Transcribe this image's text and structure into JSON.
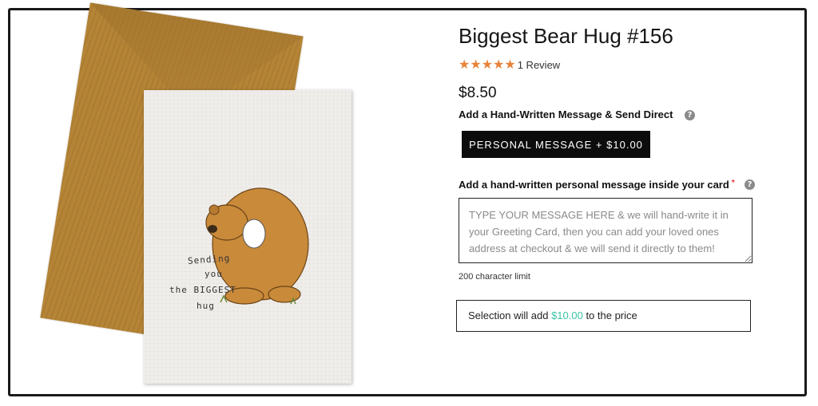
{
  "product": {
    "title": "Biggest Bear Hug #156",
    "stars": "★★★★★",
    "review_count": "1 Review",
    "price": "$8.50"
  },
  "card_illustration": {
    "line1": "Sending",
    "line2": "you",
    "line3": "the BIGGEST",
    "line4": "hug"
  },
  "options": {
    "send_direct_label": "Add a Hand-Written Message & Send Direct",
    "help_icon": "?",
    "personal_message_button": "PERSONAL MESSAGE + $10.00",
    "message_label": "Add a hand-written personal message inside your card",
    "required_mark": "*",
    "message_placeholder": "TYPE YOUR MESSAGE HERE & we will hand-write it in your Greeting Card, then you can add your loved ones address at checkout & we will send it directly to them!",
    "char_limit": "200 character limit",
    "selection_prefix": "Selection will add ",
    "selection_price": "$10.00",
    "selection_suffix": " to the price"
  },
  "colors": {
    "stars": "#e8833a",
    "selection_price": "#3cc3a5",
    "button_bg": "#0c0c0c"
  }
}
